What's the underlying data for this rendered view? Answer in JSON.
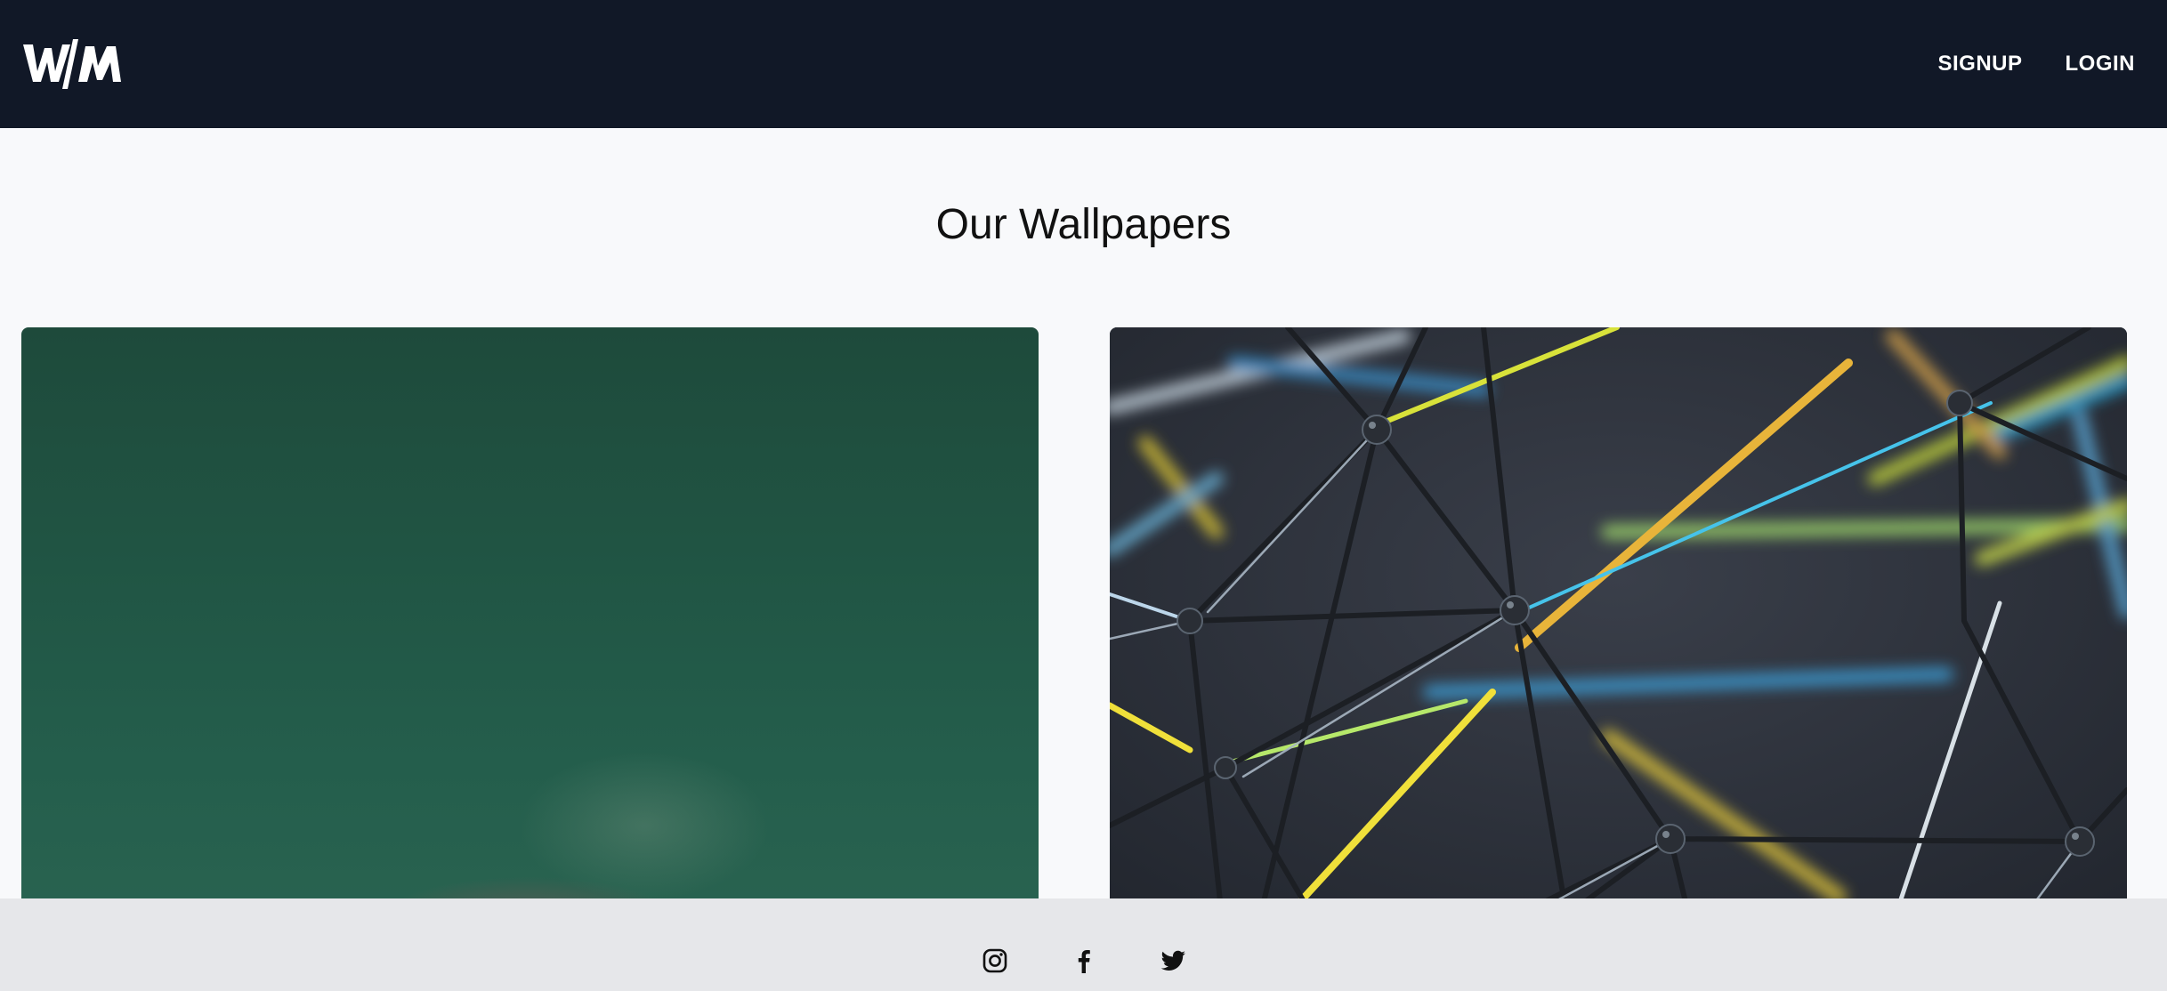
{
  "navbar": {
    "logo_text": "W/M",
    "links": [
      {
        "label": "SIGNUP"
      },
      {
        "label": "LOGIN"
      }
    ]
  },
  "main": {
    "title": "Our Wallpapers",
    "wallpapers": [
      {
        "icon": "green-blurred-wallpaper"
      },
      {
        "icon": "network-lines-wallpaper"
      }
    ]
  },
  "footer": {
    "social_icons": [
      "instagram-icon",
      "facebook-icon",
      "twitter-icon"
    ]
  },
  "colors": {
    "navbar_bg": "#111827",
    "page_bg": "#f8f9fb",
    "footer_bg": "#e6e7ea"
  }
}
